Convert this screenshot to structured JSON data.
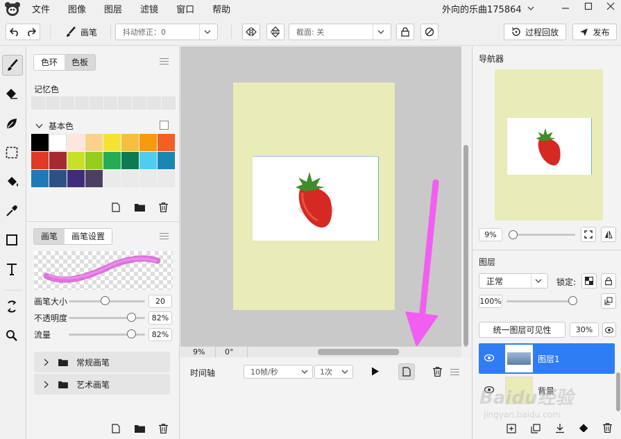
{
  "menu": {
    "items": [
      "文件",
      "图像",
      "图层",
      "滤镜",
      "窗口",
      "帮助"
    ],
    "doc_title": "外向的乐曲175864"
  },
  "toolbar": {
    "brush_label": "画笔",
    "stabilizer_label": "抖动修正：0",
    "clip_label": "截面: 关",
    "replay_label": "过程回放",
    "publish_label": "发布"
  },
  "colors_panel": {
    "tab_ring": "色环",
    "tab_swatch": "色板",
    "memory_label": "记忆色",
    "basic_label": "基本色",
    "swatches": [
      "#000000",
      "#ffffff",
      "#fde6de",
      "#fbd28c",
      "#f6e233",
      "#f7bf3d",
      "#f79a0e",
      "#f35f25",
      "#e03a24",
      "#a52a30",
      "#c9df2a",
      "#97cc1c",
      "#25ac55",
      "#0c7b54",
      "#4fcdef",
      "#1a86b3",
      "#1f7bb8",
      "#2e5185",
      "#3f2d7c",
      "#4a4063",
      "#eaeaea",
      "#eaeaea",
      "#eaeaea",
      "#eaeaea"
    ]
  },
  "brush_panel": {
    "tab_brush": "画笔",
    "tab_settings": "画笔设置",
    "size_label": "画笔大小",
    "size_value": "20",
    "size_fraction": 0.47,
    "opacity_label": "不透明度",
    "opacity_value": "82%",
    "opacity_fraction": 0.82,
    "flow_label": "流量",
    "flow_value": "82%",
    "flow_fraction": 0.82,
    "groups": [
      "常规画笔",
      "艺术画笔"
    ]
  },
  "canvas": {
    "zoom_value": "9%",
    "angle_value": "0°",
    "colors": {
      "paper": "#e9ebb8",
      "annotation_arrow": "#f25ef2"
    }
  },
  "timeline": {
    "label": "时间轴",
    "fps_value": "10帧/秒",
    "loop_value": "1次"
  },
  "navigator": {
    "title": "导航器",
    "zoom_value": "9%"
  },
  "layers": {
    "title": "图层",
    "blend_mode": "正常",
    "lock_label": "锁定:",
    "opacity_value": "100%",
    "unify_label": "统一图层可见性",
    "unify_value": "30%",
    "items": [
      {
        "name": "图层1",
        "selected": true
      },
      {
        "name": "背景",
        "selected": false
      }
    ]
  },
  "watermark": {
    "brand": "Baidu经验",
    "url": "jingyan.baidu.com"
  }
}
